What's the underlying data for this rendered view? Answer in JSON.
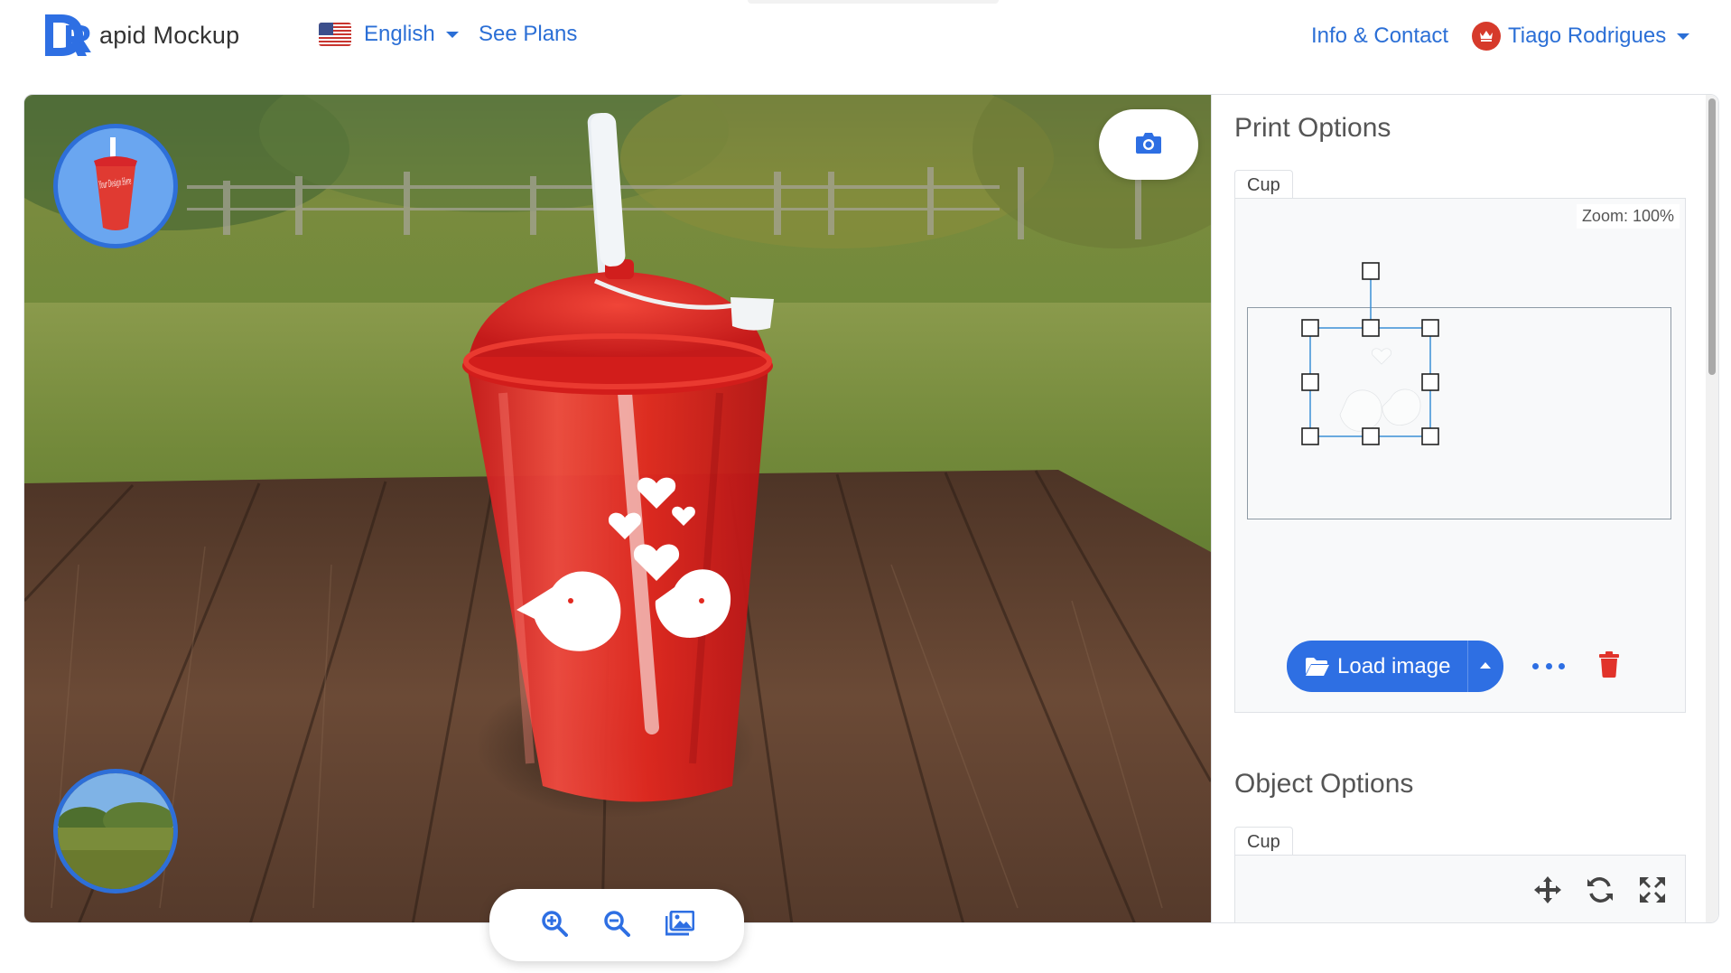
{
  "navbar": {
    "brand_letter": "R",
    "brand_text": "apid Mockup",
    "language": "English",
    "see_plans": "See Plans",
    "info_contact": "Info & Contact",
    "user_name": "Tiago Rodrigues"
  },
  "viewer": {
    "cup_thumb_text": "Your Design Here",
    "icons": {
      "camera": "camera-icon",
      "zoom_in": "zoom-in-icon",
      "zoom_out": "zoom-out-icon",
      "background": "image-gallery-icon"
    }
  },
  "print_options": {
    "title": "Print Options",
    "tab": "Cup",
    "zoom_text": "Zoom: 100%",
    "load_image": "Load image",
    "icons": {
      "load": "folder-open-icon",
      "more": "ellipsis-icon",
      "delete": "trash-icon"
    }
  },
  "object_options": {
    "title": "Object Options",
    "tab": "Cup",
    "icons": {
      "move": "move-arrows-icon",
      "rotate": "rotate-icon",
      "scale": "expand-arrows-icon"
    }
  },
  "colors": {
    "accent": "#2e6fe3",
    "link": "#2b6fd6",
    "danger": "#e1332a",
    "cup_red": "#e5231f"
  }
}
